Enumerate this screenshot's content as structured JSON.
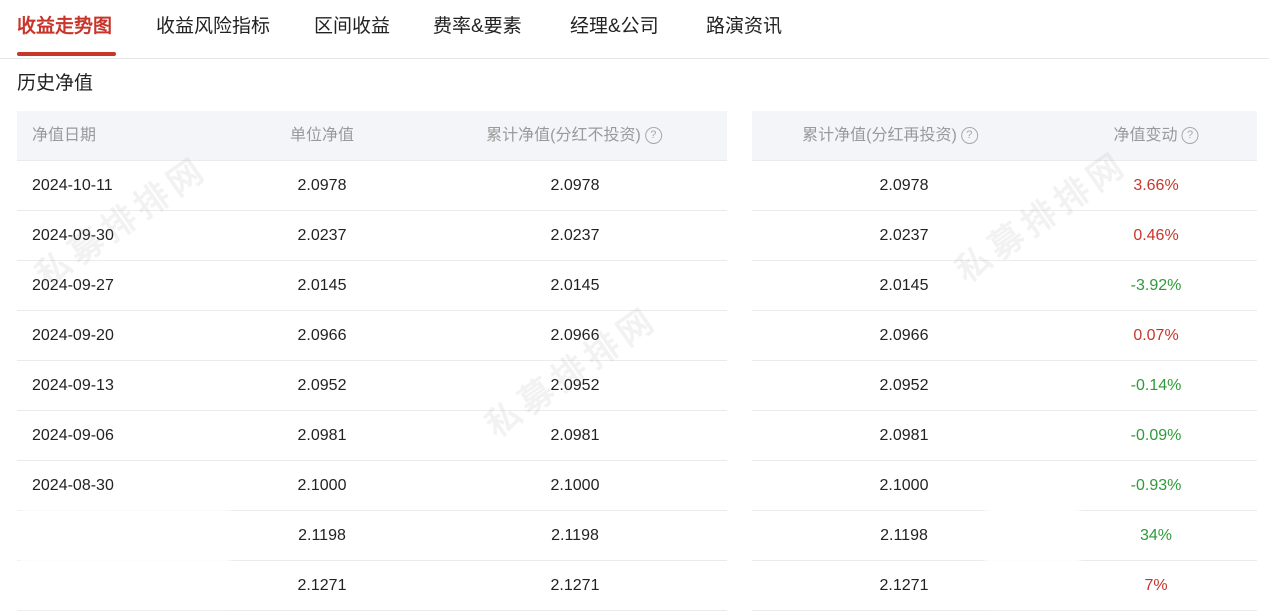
{
  "tabs": [
    {
      "label": "收益走势图",
      "active": true
    },
    {
      "label": "收益风险指标",
      "active": false
    },
    {
      "label": "区间收益",
      "active": false
    },
    {
      "label": "费率&要素",
      "active": false
    },
    {
      "label": "经理&公司",
      "active": false
    },
    {
      "label": "路演资讯",
      "active": false
    }
  ],
  "section_title": "历史净值",
  "headers": {
    "date": "净值日期",
    "unit_nav": "单位净值",
    "cum_nav_no_reinvest": "累计净值(分红不投资)",
    "cum_nav_reinvest": "累计净值(分红再投资)",
    "nav_change": "净值变动",
    "help_glyph": "?"
  },
  "rows": [
    {
      "date": "2024-10-11",
      "unit": "2.0978",
      "cum": "2.0978",
      "cum_re": "2.0978",
      "change": "3.66%",
      "dir": "up"
    },
    {
      "date": "2024-09-30",
      "unit": "2.0237",
      "cum": "2.0237",
      "cum_re": "2.0237",
      "change": "0.46%",
      "dir": "up"
    },
    {
      "date": "2024-09-27",
      "unit": "2.0145",
      "cum": "2.0145",
      "cum_re": "2.0145",
      "change": "-3.92%",
      "dir": "down"
    },
    {
      "date": "2024-09-20",
      "unit": "2.0966",
      "cum": "2.0966",
      "cum_re": "2.0966",
      "change": "0.07%",
      "dir": "up"
    },
    {
      "date": "2024-09-13",
      "unit": "2.0952",
      "cum": "2.0952",
      "cum_re": "2.0952",
      "change": "-0.14%",
      "dir": "down"
    },
    {
      "date": "2024-09-06",
      "unit": "2.0981",
      "cum": "2.0981",
      "cum_re": "2.0981",
      "change": "-0.09%",
      "dir": "down"
    },
    {
      "date": "2024-08-30",
      "unit": "2.1000",
      "cum": "2.1000",
      "cum_re": "2.1000",
      "change": "-0.93%",
      "dir": "down"
    },
    {
      "date": "",
      "unit": "2.1198",
      "cum": "2.1198",
      "cum_re": "2.1198",
      "change": "34%",
      "dir": "down"
    },
    {
      "date": "",
      "unit": "2.1271",
      "cum": "2.1271",
      "cum_re": "2.1271",
      "change": "7%",
      "dir": "up"
    }
  ],
  "watermark_text": "私募排排网",
  "colors": {
    "accent": "#c8352b",
    "up": "#c8352b",
    "down": "#2e9a3a",
    "header_bg": "#f4f5f9"
  }
}
